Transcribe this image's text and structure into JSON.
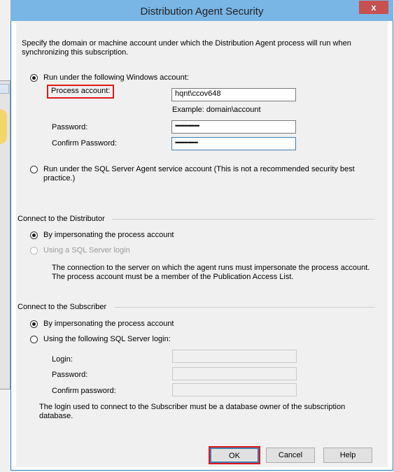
{
  "dialog": {
    "title": "Distribution Agent Security",
    "close_label": "x",
    "intro": "Specify the domain or machine account under which the Distribution Agent process will run when synchronizing this subscription."
  },
  "process_account_section": {
    "windows_account_radio": {
      "label": "Run under the following Windows account:",
      "checked": true
    },
    "process_account_label": "Process account:",
    "process_account_value": "hqnt\\ccov648",
    "example_text": "Example: domain\\account",
    "password_label": "Password:",
    "password_value": "••••••••••••••••",
    "confirm_password_label": "Confirm Password:",
    "confirm_password_value": "•••••••••••••••",
    "sql_agent_radio": {
      "label": "Run under the SQL Server Agent service account (This is not a recommended security best practice.)",
      "checked": false
    }
  },
  "distributor_section": {
    "title": "Connect to the Distributor",
    "impersonate_radio": {
      "label": "By impersonating the process account",
      "checked": true
    },
    "sql_login_radio": {
      "label": "Using a SQL Server login",
      "checked": false,
      "disabled": true
    },
    "note": "The connection to the server on which the agent runs must impersonate the process account. The process account must be a member of the Publication Access List."
  },
  "subscriber_section": {
    "title": "Connect to the Subscriber",
    "impersonate_radio": {
      "label": "By impersonating the process account",
      "checked": true
    },
    "sql_login_radio": {
      "label": "Using the following SQL Server login:",
      "checked": false
    },
    "login_label": "Login:",
    "password_label": "Password:",
    "confirm_password_label": "Confirm password:",
    "note": "The login used to connect to the Subscriber must be a database owner of the subscription database."
  },
  "buttons": {
    "ok": "OK",
    "cancel": "Cancel",
    "help": "Help"
  },
  "colors": {
    "titlebar": "#79b5e5",
    "close": "#c75050",
    "highlight": "#e0161c",
    "border": "#2d7fc6"
  }
}
